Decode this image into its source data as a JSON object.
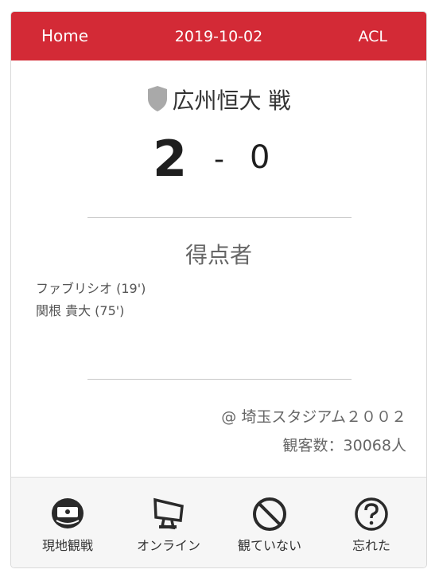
{
  "header": {
    "home_label": "Home",
    "date": "2019-10-02",
    "competition": "ACL",
    "color": "#d32a36"
  },
  "match": {
    "opponent": "広州恒大 戦",
    "opponent_icon": "shield-icon",
    "score_home": "2",
    "score_separator": "-",
    "score_away": "0"
  },
  "scorers": {
    "title": "得点者",
    "items": [
      "ファブリシオ (19')",
      "関根 貴大 (75')"
    ]
  },
  "venue": {
    "name": "@ 埼玉スタジアム２００２",
    "attendance": "観客数：30068人"
  },
  "actions": [
    {
      "label": "現地観戦",
      "icon": "stadium-icon"
    },
    {
      "label": "オンライン",
      "icon": "monitor-icon"
    },
    {
      "label": "観ていない",
      "icon": "prohibited-icon"
    },
    {
      "label": "忘れた",
      "icon": "question-icon"
    }
  ]
}
